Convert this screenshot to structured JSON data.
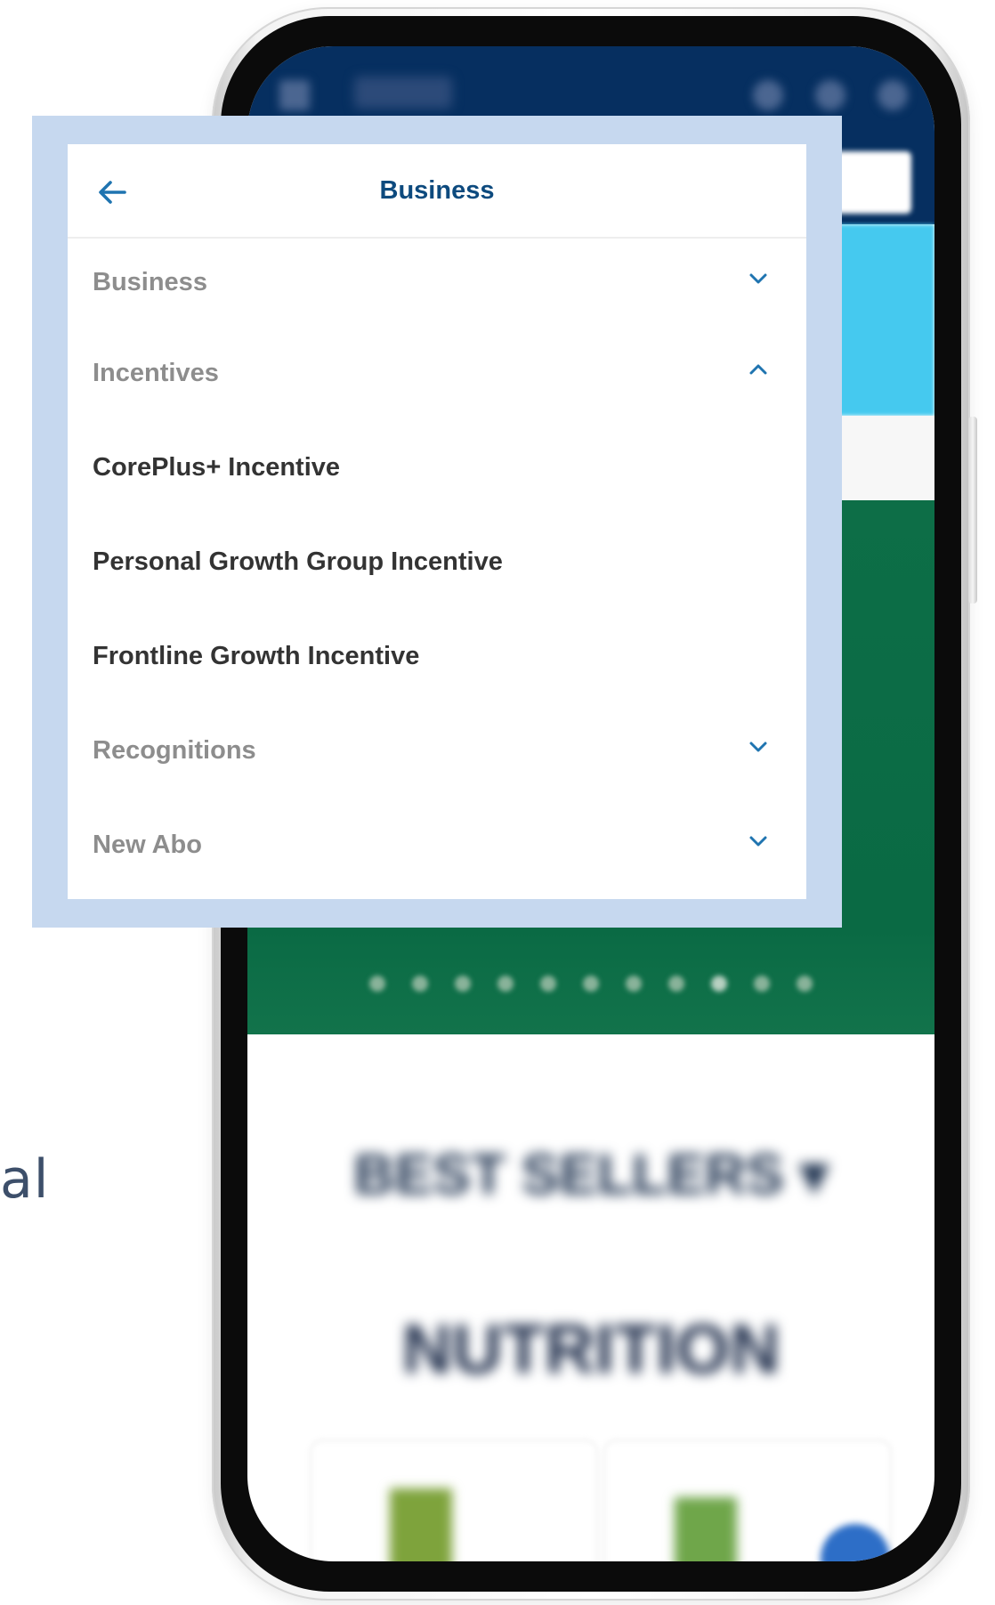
{
  "caption_fragment": "al",
  "background_app": {
    "best_sellers_label": "BEST SELLERS ▾",
    "section_title": "NUTRITION"
  },
  "menu": {
    "title": "Business",
    "items": [
      {
        "label": "Business",
        "type": "section",
        "expanded": false
      },
      {
        "label": "Incentives",
        "type": "section",
        "expanded": true
      },
      {
        "label": "CorePlus+ Incentive",
        "type": "link"
      },
      {
        "label": "Personal Growth Group Incentive",
        "type": "link"
      },
      {
        "label": "Frontline Growth Incentive",
        "type": "link"
      },
      {
        "label": "Recognitions",
        "type": "section",
        "expanded": false
      },
      {
        "label": "New Abo",
        "type": "section",
        "expanded": false
      }
    ]
  },
  "colors": {
    "accent": "#0d4a7e",
    "icon_blue": "#1f74b0",
    "highlight": "#c6d8ef",
    "section_text": "#8d8d8d",
    "link_text": "#333333",
    "header_navy": "#062f60",
    "banner_green": "#0d6e47"
  },
  "icons": {
    "back": "arrow-left-icon",
    "collapsed": "chevron-down-icon",
    "expanded": "chevron-up-icon"
  }
}
